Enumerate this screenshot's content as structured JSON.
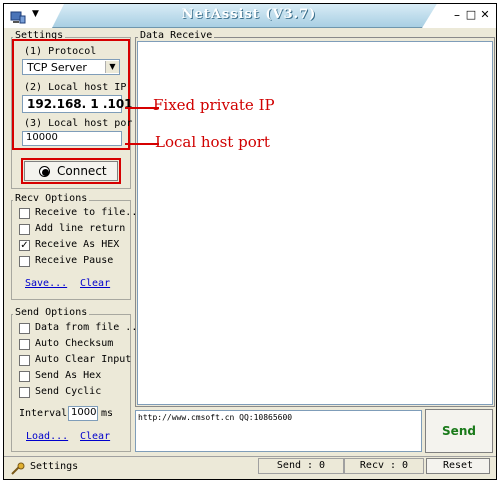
{
  "window": {
    "title": "NetAssist (V3.7)",
    "controls": {
      "minimize": "–",
      "maximize": "□",
      "close": "✕"
    }
  },
  "settings": {
    "legend": "Settings",
    "protocol_label": "(1) Protocol",
    "protocol_value": "TCP Server",
    "local_ip_label": "(2) Local host IP",
    "local_ip_value": "192.168. 1 .101",
    "local_port_label": "(3) Local host por",
    "local_port_value": "10000",
    "connect_label": "Connect"
  },
  "recv_options": {
    "legend": "Recv Options",
    "items": [
      {
        "label": "Receive to file...",
        "checked": false
      },
      {
        "label": "Add line return",
        "checked": false
      },
      {
        "label": "Receive As HEX",
        "checked": true
      },
      {
        "label": "Receive Pause",
        "checked": false
      }
    ],
    "save_label": "Save...",
    "clear_label": "Clear"
  },
  "send_options": {
    "legend": "Send Options",
    "items": [
      {
        "label": "Data from file ...",
        "checked": false
      },
      {
        "label": "Auto Checksum",
        "checked": false
      },
      {
        "label": "Auto Clear Input",
        "checked": false
      },
      {
        "label": "Send As Hex",
        "checked": false
      },
      {
        "label": "Send Cyclic",
        "checked": false
      }
    ],
    "interval_label": "Interval",
    "interval_value": "1000",
    "interval_unit": "ms",
    "load_label": "Load...",
    "clear_label": "Clear"
  },
  "data_receive": {
    "legend": "Data Receive"
  },
  "send_area": {
    "text": "http://www.cmsoft.cn QQ:10865600",
    "send_label": "Send"
  },
  "status_bar": {
    "settings_label": "Settings",
    "send_count": "Send : 0",
    "recv_count": "Recv : 0",
    "reset_label": "Reset"
  },
  "annotations": {
    "fixed_ip": "Fixed private IP",
    "local_port": "Local host port"
  },
  "colors": {
    "annotation_red": "#d60000",
    "send_green": "#1a7a1a",
    "link_blue": "#0000cc"
  }
}
